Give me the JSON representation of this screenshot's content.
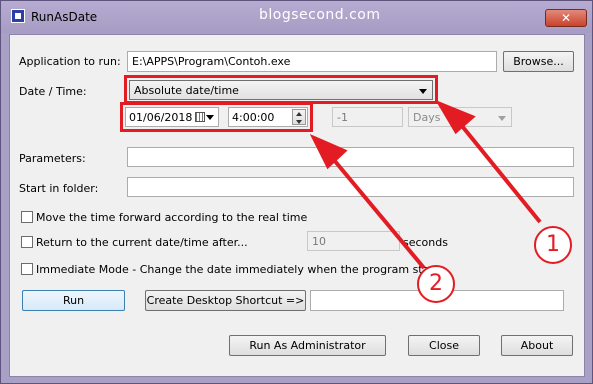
{
  "window": {
    "title": "RunAsDate",
    "watermark": "blogsecond.com",
    "close_glyph": "✕"
  },
  "form": {
    "app_label": "Application to run:",
    "app_value": "E:\\APPS\\Program\\Contoh.exe",
    "browse_label": "Browse...",
    "datetime_label": "Date / Time:",
    "datetime_mode": "Absolute date/time",
    "date_value": "01/06/2018",
    "time_value": "4:00:00",
    "offset_value": "-1",
    "offset_unit": "Days",
    "parameters_label": "Parameters:",
    "parameters_value": "",
    "start_folder_label": "Start in folder:",
    "start_folder_value": "",
    "move_time_label": "Move the time forward according to the real time",
    "return_label": "Return to the current date/time after...",
    "return_seconds": "10",
    "seconds_label": "seconds",
    "immediate_label": "Immediate Mode - Change the date immediately when the program starts",
    "run_label": "Run",
    "shortcut_label": "Create Desktop Shortcut =>",
    "shortcut_name": "",
    "run_admin_label": "Run As Administrator",
    "close_label": "Close",
    "about_label": "About"
  },
  "annotations": {
    "marker_1": "1",
    "marker_2": "2",
    "color": "#e31b23"
  },
  "colors": {
    "frame": "#a9a0c6",
    "client": "#f0f0f0",
    "accent": "#3c7fb1"
  }
}
